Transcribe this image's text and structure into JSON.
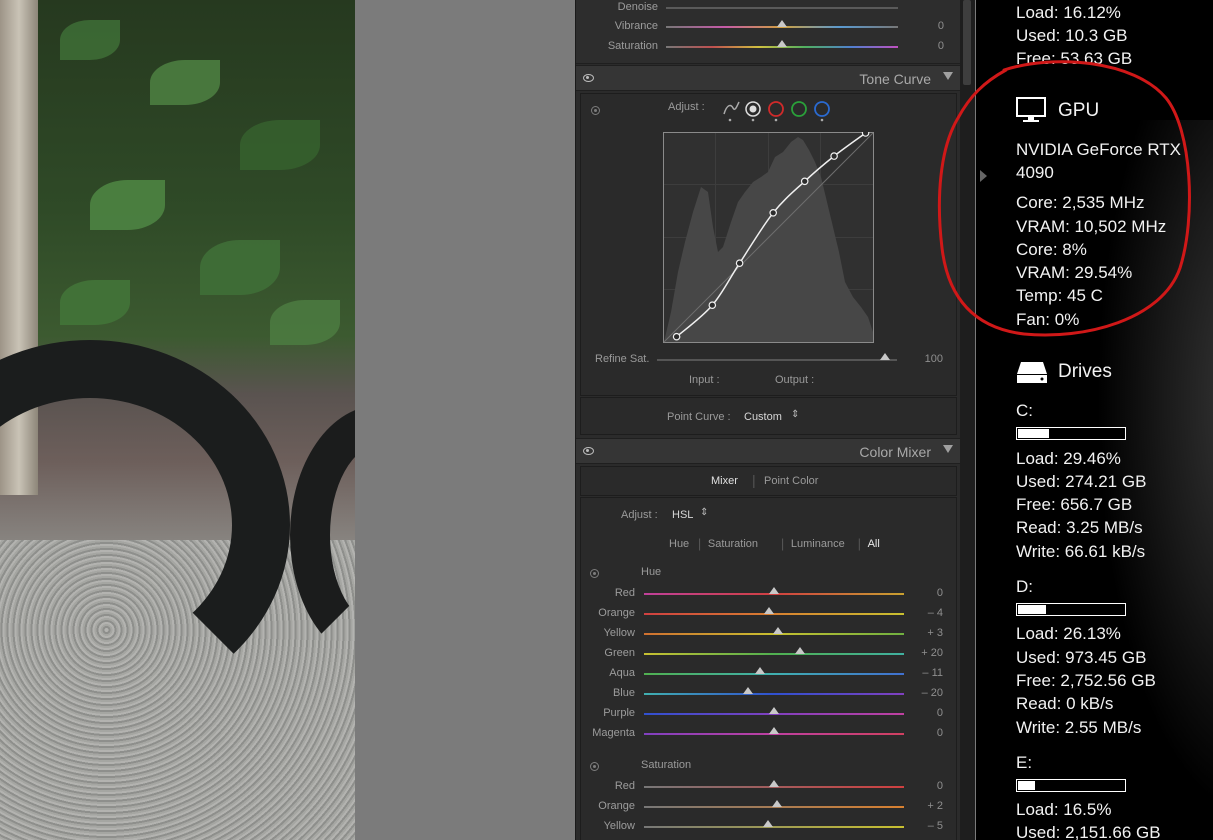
{
  "develop": {
    "partial_label": "Denoise",
    "vibrance": {
      "label": "Vibrance",
      "value": "0",
      "level": 0.5
    },
    "saturation": {
      "label": "Saturation",
      "value": "0",
      "level": 0.5
    },
    "tone_curve": {
      "title": "Tone Curve",
      "adjust_label": "Adjust :",
      "channel_icons": [
        "parametric-curve-icon",
        "white-channel-icon",
        "red-channel-icon",
        "green-channel-icon",
        "blue-channel-icon"
      ],
      "refine_sat_label": "Refine Sat.",
      "refine_sat_value": "100",
      "refine_sat_level": 0.95,
      "input_label": "Input :",
      "output_label": "Output :",
      "point_curve_label": "Point Curve :",
      "point_curve_value": "Custom",
      "curve_points": [
        [
          0.06,
          0.03
        ],
        [
          0.23,
          0.18
        ],
        [
          0.36,
          0.38
        ],
        [
          0.52,
          0.62
        ],
        [
          0.67,
          0.77
        ],
        [
          0.81,
          0.89
        ],
        [
          0.96,
          1.0
        ]
      ]
    },
    "color_mixer": {
      "title": "Color Mixer",
      "tab_mixer": "Mixer",
      "tab_point_color": "Point Color",
      "adjust_label": "Adjust :",
      "adjust_value": "HSL",
      "sub_tabs": [
        "Hue",
        "Saturation",
        "Luminance",
        "All"
      ],
      "hue_header": "Hue",
      "hue": [
        {
          "label": "Red",
          "value": "0",
          "level": 0.5
        },
        {
          "label": "Orange",
          "value": "– 4",
          "level": 0.48
        },
        {
          "label": "Yellow",
          "value": "+ 3",
          "level": 0.515
        },
        {
          "label": "Green",
          "value": "+ 20",
          "level": 0.6
        },
        {
          "label": "Aqua",
          "value": "– 11",
          "level": 0.445
        },
        {
          "label": "Blue",
          "value": "– 20",
          "level": 0.4
        },
        {
          "label": "Purple",
          "value": "0",
          "level": 0.5
        },
        {
          "label": "Magenta",
          "value": "0",
          "level": 0.5
        }
      ],
      "saturation_header": "Saturation",
      "saturation": [
        {
          "label": "Red",
          "value": "0",
          "level": 0.5
        },
        {
          "label": "Orange",
          "value": "+ 2",
          "level": 0.51
        },
        {
          "label": "Yellow",
          "value": "– 5",
          "level": 0.475
        }
      ]
    }
  },
  "monitor": {
    "memory": {
      "load": "Load: 16.12%",
      "used": "Used: 10.3 GB",
      "free": "Free: 53.63 GB"
    },
    "gpu": {
      "title": "GPU",
      "name_line1": "NVIDIA GeForce RTX",
      "name_line2": "4090",
      "core_clock": "Core: 2,535 MHz",
      "vram_clock": "VRAM: 10,502 MHz",
      "core_load": "Core: 8%",
      "vram_load": "VRAM: 29.54%",
      "temp": "Temp: 45 C",
      "fan": "Fan: 0%"
    },
    "drives_title": "Drives",
    "drives": [
      {
        "name": "C:",
        "usage": 0.2946,
        "load": "Load: 29.46%",
        "used": "Used: 274.21 GB",
        "free": "Free: 656.7 GB",
        "read": "Read: 3.25 MB/s",
        "write": "Write: 66.61 kB/s"
      },
      {
        "name": "D:",
        "usage": 0.2613,
        "load": "Load: 26.13%",
        "used": "Used: 973.45 GB",
        "free": "Free: 2,752.56 GB",
        "read": "Read: 0 kB/s",
        "write": "Write: 2.55 MB/s"
      },
      {
        "name": "E:",
        "usage": 0.165,
        "load": "Load: 16.5%",
        "used": "Used: 2,151.66 GB"
      }
    ]
  },
  "colors": {
    "annotation_red": "#d01818",
    "panel_bg": "#2b2b2b"
  }
}
